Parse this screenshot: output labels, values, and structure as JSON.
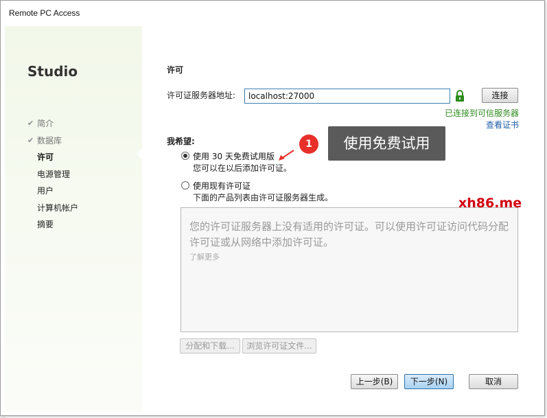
{
  "window": {
    "title": "Remote PC Access"
  },
  "sidebar": {
    "brand": "Studio",
    "steps": [
      {
        "label": "简介",
        "state": "done"
      },
      {
        "label": "数据库",
        "state": "done"
      },
      {
        "label": "许可",
        "state": "current"
      },
      {
        "label": "电源管理",
        "state": "pending"
      },
      {
        "label": "用户",
        "state": "pending"
      },
      {
        "label": "计算机帐户",
        "state": "pending"
      },
      {
        "label": "摘要",
        "state": "pending"
      }
    ],
    "check_glyph": "✔"
  },
  "main": {
    "section_title": "许可",
    "server": {
      "label": "许可证服务器地址:",
      "value": "localhost:27000",
      "connect_label": "连接",
      "status": "已连接到可信服务器",
      "view_cert": "查看证书"
    },
    "preference_label": "我希望:",
    "options": [
      {
        "label": "使用 30 天免费试用版",
        "desc": "您可以在以后添加许可证。",
        "selected": true
      },
      {
        "label": "使用现有许可证",
        "desc": "下面的产品列表由许可证服务器生成。",
        "selected": false
      }
    ],
    "product_box": {
      "message": "您的许可证服务器上没有适用的许可证。可以使用许可证访问代码分配许可证或从网络中添加许可证。",
      "learn_more": "了解更多"
    },
    "allocate_label": "分配和下载...",
    "browse_label": "浏览许可证文件...",
    "nav": {
      "back": "上一步(B)",
      "next": "下一步(N)",
      "cancel": "取消"
    }
  },
  "annotation": {
    "badge": "1",
    "text": "使用免费试用"
  },
  "watermark": "xh86.me",
  "colors": {
    "accent_blue": "#3c7fb1",
    "status_green": "#2e8b1e",
    "badge_red": "#e8302a",
    "callout_gray": "#5a5a5a"
  }
}
